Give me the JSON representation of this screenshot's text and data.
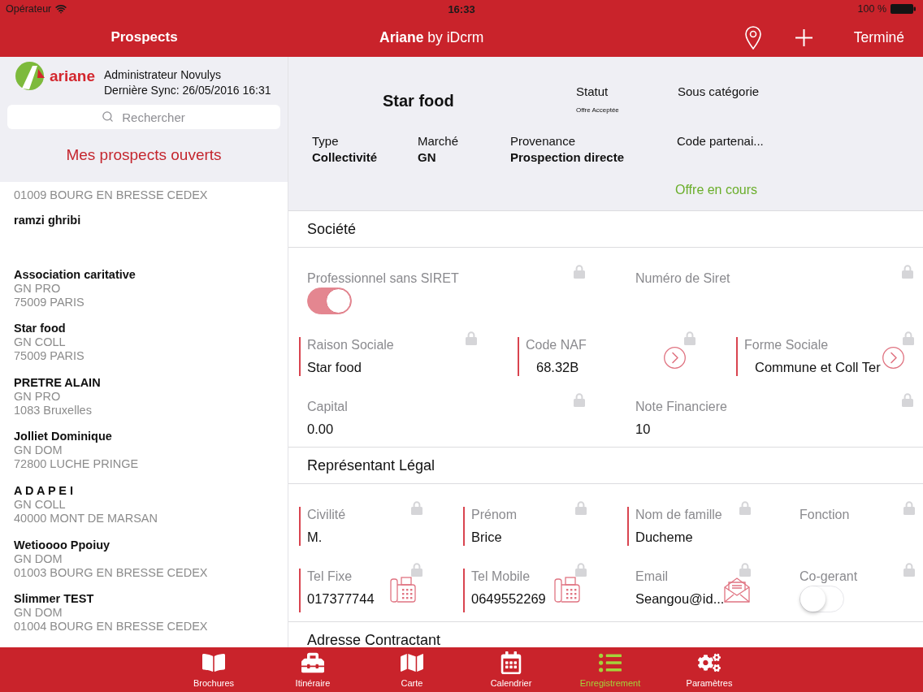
{
  "status_bar": {
    "carrier": "Opérateur",
    "time": "16:33",
    "battery": "100 %"
  },
  "nav_bar": {
    "sidebar_title": "Prospects",
    "title": "**Ariane** by iDcrm",
    "done_button": "Terminé"
  },
  "sidebar": {
    "logo_text": "ariane",
    "user": "Administrateur Novulys",
    "last_sync": "Dernière Sync: 26/05/2016 16:31",
    "search": {
      "placeholder": "Rechercher"
    },
    "list_title": "Mes prospects ouverts",
    "prospects": [
      {
        "lines": [
          "01009 BOURG EN BRESSE CEDEX"
        ]
      },
      {
        "name": "ramzi ghribi"
      },
      {
        "name": "Association caritative",
        "lines": [
          "GN PRO",
          "75009 PARIS"
        ]
      },
      {
        "name": "Star food",
        "lines": [
          "GN COLL",
          "75009 PARIS"
        ]
      },
      {
        "name": "PRETRE ALAIN",
        "lines": [
          "GN PRO",
          "1083 Bruxelles"
        ]
      },
      {
        "name": "Jolliet Dominique",
        "lines": [
          "GN DOM",
          "72800 LUCHE PRINGE"
        ]
      },
      {
        "name": "A D A P E I",
        "lines": [
          "GN COLL",
          "40000 MONT DE MARSAN"
        ]
      },
      {
        "name": "Wetioooo Ppoiuy",
        "lines": [
          "GN DOM",
          "01003 BOURG EN BRESSE CEDEX"
        ]
      },
      {
        "name": "Slimmer TEST",
        "lines": [
          "GN DOM",
          "01004 BOURG EN BRESSE CEDEX"
        ]
      }
    ]
  },
  "detail": {
    "title": "Star food",
    "status": {
      "label": "Statut",
      "value": "Offre Acceptée"
    },
    "subcategory": {
      "label": "Sous catégorie"
    },
    "summary": [
      {
        "label": "Type",
        "value": "Collectivité"
      },
      {
        "label": "Marché",
        "value": "GN"
      },
      {
        "label": "Provenance",
        "value": "Prospection directe"
      },
      {
        "label": "Code partenai..."
      }
    ],
    "offer_status": "Offre en cours"
  },
  "sections": [
    {
      "title": "Société",
      "rows": [
        {
          "fields": [
            {
              "kind": "toggle",
              "label": "Professionnel sans SIRET",
              "on": true,
              "required": false,
              "locked": true
            },
            {
              "kind": "text",
              "label": "Numéro de Siret",
              "required": false,
              "locked": true
            }
          ]
        },
        {
          "fields": [
            {
              "kind": "text",
              "label": "Raison Sociale",
              "value": "Star food",
              "required": true,
              "locked": true
            },
            {
              "kind": "picker",
              "label": "Code NAF",
              "value": "68.32B",
              "required": true,
              "locked": true
            },
            {
              "kind": "picker",
              "label": "Forme Sociale",
              "value": "Commune et Coll Ter",
              "required": true,
              "locked": true
            }
          ]
        },
        {
          "fields": [
            {
              "kind": "text",
              "label": "Capital",
              "value": "0.00",
              "required": false,
              "locked": true
            },
            {
              "kind": "text",
              "label": "Note Financiere",
              "value": "10",
              "required": false,
              "locked": true
            }
          ]
        }
      ]
    },
    {
      "title": "Représentant Légal",
      "rows": [
        {
          "fields": [
            {
              "kind": "text",
              "label": "Civilité",
              "value": "M.",
              "required": true,
              "locked": true
            },
            {
              "kind": "text",
              "label": "Prénom",
              "value": "Brice",
              "required": true,
              "locked": true
            },
            {
              "kind": "text",
              "label": "Nom de famille",
              "value": "Ducheme",
              "required": true,
              "locked": true
            },
            {
              "kind": "text",
              "label": "Fonction",
              "required": false,
              "locked": true
            }
          ]
        },
        {
          "fields": [
            {
              "kind": "phone",
              "label": "Tel Fixe",
              "value": "017377744",
              "required": true,
              "locked": true
            },
            {
              "kind": "phone",
              "label": "Tel Mobile",
              "value": "0649552269",
              "required": true,
              "locked": true
            },
            {
              "kind": "email",
              "label": "Email",
              "value": "Seangou@id...",
              "required": false,
              "locked": true
            },
            {
              "kind": "toggle",
              "label": "Co-gerant",
              "on": false,
              "required": false,
              "locked": true
            }
          ]
        }
      ]
    },
    {
      "title": "Adresse Contractant"
    }
  ],
  "tab_bar": [
    {
      "label": "Brochures",
      "selected": false
    },
    {
      "label": "Itinéraire",
      "selected": false
    },
    {
      "label": "Carte",
      "selected": false
    },
    {
      "label": "Calendrier",
      "selected": false
    },
    {
      "label": "Enregistrement",
      "selected": true
    },
    {
      "label": "Paramètres",
      "selected": false
    }
  ]
}
